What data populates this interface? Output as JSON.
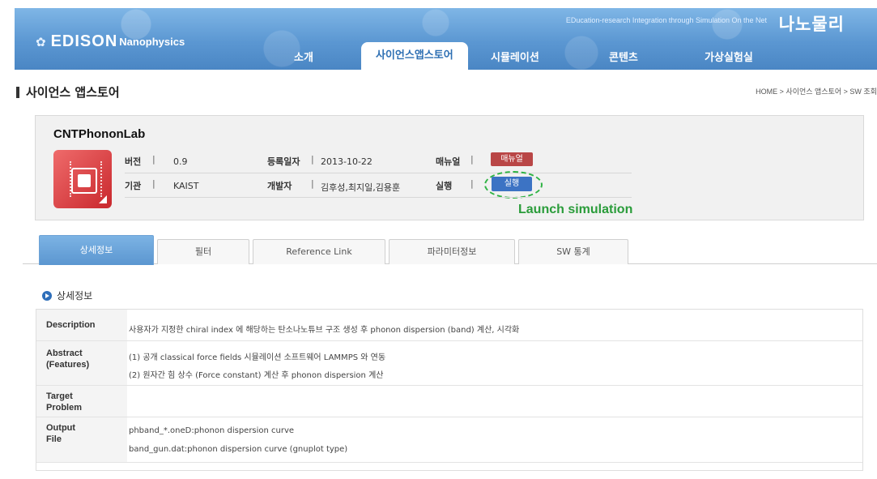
{
  "header": {
    "logo_icon": "atom-icon",
    "logo_main": "EDISON",
    "logo_sub": "Nanophysics",
    "tagline": "EDucation-research Integration through Simulation On the Net",
    "brand_ko": "나노물리",
    "nav": [
      "소개",
      "사이언스앱스토어",
      "시뮬레이션",
      "콘텐츠",
      "가상실험실"
    ],
    "active_nav": "사이언스앱스토어",
    "colors": {
      "header_blue": "#5b97d2",
      "active_text": "#2d6fb3"
    }
  },
  "page": {
    "title": "사이언스 앱스토어",
    "breadcrumb": "HOME > 사이언스 앱스토어 > SW 조회"
  },
  "app": {
    "name": "CNTPhononLab",
    "icon": "chip-icon",
    "version_label": "버전",
    "version": "0.9",
    "registered_label": "등록일자",
    "registered": "2013-10-22",
    "manual_label": "매뉴얼",
    "manual_button": "매뉴얼",
    "org_label": "기관",
    "org": "KAIST",
    "developer_label": "개발자",
    "developers": "김후성,최지일,김용훈",
    "run_label": "실행",
    "run_button": "실행",
    "annotation": "Launch simulation",
    "colors": {
      "manual_button": "#b94646",
      "run_button": "#3c73c4",
      "annotation": "#2a9c3a"
    }
  },
  "tabs": [
    "상세정보",
    "필터",
    "Reference Link",
    "파라미터정보",
    "SW 통계"
  ],
  "active_tab": "상세정보",
  "details": {
    "section_title": "상세정보",
    "rows": [
      {
        "label": "Description",
        "values": [
          "사용자가 지정한 chiral index 에 해당하는 탄소나노튜브 구조 생성 후 phonon dispersion (band) 계산, 시각화"
        ]
      },
      {
        "label": "Abstract (Features)",
        "values": [
          "(1) 공개 classical force fields 시뮬레이션 소프트웨어 LAMMPS 와 연동",
          "(2) 원자간 힘 상수 (Force constant) 계산 후 phonon dispersion 계산"
        ]
      },
      {
        "label": "Target Problem",
        "values": []
      },
      {
        "label": "Output File",
        "values": [
          "phband_*.oneD:phonon dispersion curve",
          "band_gun.dat:phonon dispersion curve (gnuplot type)"
        ]
      }
    ]
  }
}
